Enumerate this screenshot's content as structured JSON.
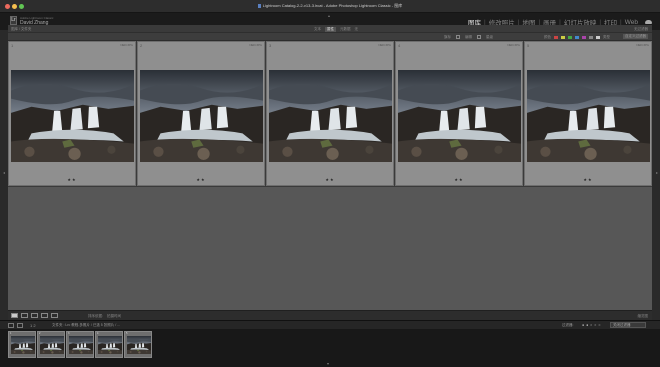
{
  "window": {
    "title": "Lightroom Catalog-2-2-v13-3.lrcat - Adobe Photoshop Lightroom Classic - 图库"
  },
  "identity": {
    "logo_label": "Lr",
    "line1": "Adobe Lightroom Classic",
    "user": "David Zhang"
  },
  "modules": [
    {
      "label": "图库",
      "active": true
    },
    {
      "label": "修改照片",
      "active": false
    },
    {
      "label": "地图",
      "active": false
    },
    {
      "label": "画册",
      "active": false
    },
    {
      "label": "幻灯片放映",
      "active": false
    },
    {
      "label": "打印",
      "active": false
    },
    {
      "label": "Web",
      "active": false
    }
  ],
  "path_bar": {
    "left": "图库 / 文件夹",
    "tabs": [
      "文本",
      "属性",
      "元数据",
      "无"
    ],
    "active_tab": "属性",
    "right": "无过滤器"
  },
  "filter_bar": {
    "left_items": [
      "旗标",
      "编辑"
    ],
    "rating_label": "星级",
    "color_label": "颜色",
    "kind_label": "类型",
    "custom_label": "自定义过滤器",
    "swatches": [
      "#c44",
      "#cc4",
      "#4a4",
      "#48c",
      "#a4a",
      "#888",
      "#ccc"
    ]
  },
  "grid": {
    "cells": [
      {
        "number": "1",
        "ext": "NEF/JPG",
        "rating": "★★"
      },
      {
        "number": "2",
        "ext": "NEF/JPG",
        "rating": "★★"
      },
      {
        "number": "3",
        "ext": "NEF/JPG",
        "rating": "★★"
      },
      {
        "number": "4",
        "ext": "NEF/JPG",
        "rating": "★★"
      },
      {
        "number": "5",
        "ext": "NEF/JPG",
        "rating": "★★"
      }
    ]
  },
  "toolbar": {
    "sort_label": "排序依据:",
    "sort_value": "拍摄时间",
    "right_label": "缩览图"
  },
  "filmstrip": {
    "nav": "1  2",
    "path": "文件夹 : Lrc 教程-多照片 / 已选 5 张照片 / ...",
    "filter_label": "过滤器:",
    "filter_value": "关闭过滤器",
    "thumbs": [
      "1",
      "2",
      "3",
      "4",
      "5"
    ]
  }
}
